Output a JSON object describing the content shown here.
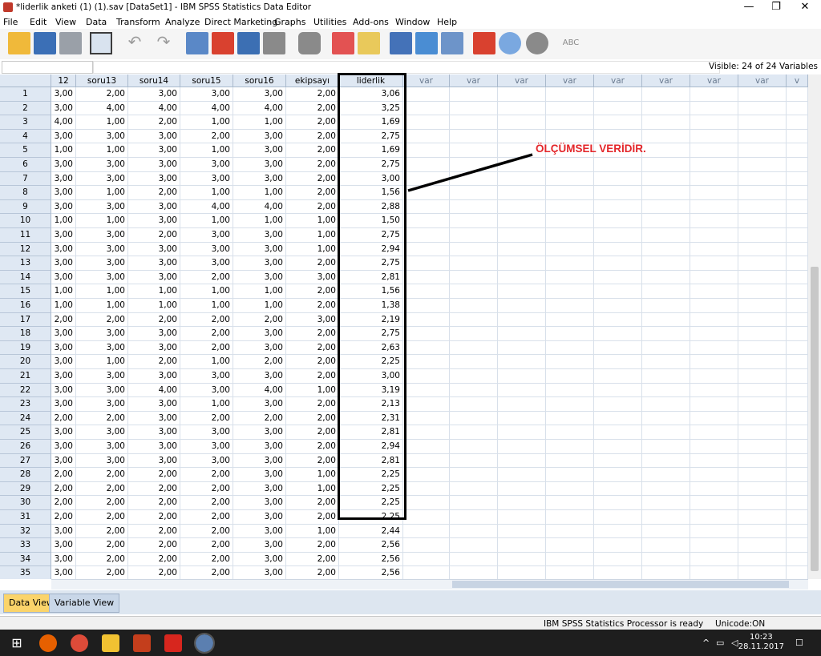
{
  "window": {
    "title": "*liderlik anketi (1) (1).sav [DataSet1] - IBM SPSS Statistics Data Editor"
  },
  "menu": [
    "File",
    "Edit",
    "View",
    "Data",
    "Transform",
    "Analyze",
    "Direct Marketing",
    "Graphs",
    "Utilities",
    "Add-ons",
    "Window",
    "Help"
  ],
  "cellbar": {
    "visible_text": "Visible: 24 of 24 Variables"
  },
  "columns": [
    "12",
    "soru13",
    "soru14",
    "soru15",
    "soru16",
    "ekipsayı",
    "liderlik",
    "var",
    "var",
    "var",
    "var",
    "var",
    "var",
    "var",
    "var",
    "v"
  ],
  "rows": [
    [
      "1",
      "3,00",
      "2,00",
      "3,00",
      "3,00",
      "3,00",
      "2,00",
      "3,06"
    ],
    [
      "2",
      "3,00",
      "4,00",
      "4,00",
      "4,00",
      "4,00",
      "2,00",
      "3,25"
    ],
    [
      "3",
      "4,00",
      "1,00",
      "2,00",
      "1,00",
      "1,00",
      "2,00",
      "1,69"
    ],
    [
      "4",
      "3,00",
      "3,00",
      "3,00",
      "2,00",
      "3,00",
      "2,00",
      "2,75"
    ],
    [
      "5",
      "1,00",
      "1,00",
      "3,00",
      "1,00",
      "3,00",
      "2,00",
      "1,69"
    ],
    [
      "6",
      "3,00",
      "3,00",
      "3,00",
      "3,00",
      "3,00",
      "2,00",
      "2,75"
    ],
    [
      "7",
      "3,00",
      "3,00",
      "3,00",
      "3,00",
      "3,00",
      "2,00",
      "3,00"
    ],
    [
      "8",
      "3,00",
      "1,00",
      "2,00",
      "1,00",
      "1,00",
      "2,00",
      "1,56"
    ],
    [
      "9",
      "3,00",
      "3,00",
      "3,00",
      "4,00",
      "4,00",
      "2,00",
      "2,88"
    ],
    [
      "10",
      "1,00",
      "1,00",
      "3,00",
      "1,00",
      "1,00",
      "1,00",
      "1,50"
    ],
    [
      "11",
      "3,00",
      "3,00",
      "2,00",
      "3,00",
      "3,00",
      "1,00",
      "2,75"
    ],
    [
      "12",
      "3,00",
      "3,00",
      "3,00",
      "3,00",
      "3,00",
      "1,00",
      "2,94"
    ],
    [
      "13",
      "3,00",
      "3,00",
      "3,00",
      "3,00",
      "3,00",
      "2,00",
      "2,75"
    ],
    [
      "14",
      "3,00",
      "3,00",
      "3,00",
      "2,00",
      "3,00",
      "3,00",
      "2,81"
    ],
    [
      "15",
      "1,00",
      "1,00",
      "1,00",
      "1,00",
      "1,00",
      "2,00",
      "1,56"
    ],
    [
      "16",
      "1,00",
      "1,00",
      "1,00",
      "1,00",
      "1,00",
      "2,00",
      "1,38"
    ],
    [
      "17",
      "2,00",
      "2,00",
      "2,00",
      "2,00",
      "2,00",
      "3,00",
      "2,19"
    ],
    [
      "18",
      "3,00",
      "3,00",
      "3,00",
      "2,00",
      "3,00",
      "2,00",
      "2,75"
    ],
    [
      "19",
      "3,00",
      "3,00",
      "3,00",
      "2,00",
      "3,00",
      "2,00",
      "2,63"
    ],
    [
      "20",
      "3,00",
      "1,00",
      "2,00",
      "1,00",
      "2,00",
      "2,00",
      "2,25"
    ],
    [
      "21",
      "3,00",
      "3,00",
      "3,00",
      "3,00",
      "3,00",
      "2,00",
      "3,00"
    ],
    [
      "22",
      "3,00",
      "3,00",
      "4,00",
      "3,00",
      "4,00",
      "1,00",
      "3,19"
    ],
    [
      "23",
      "3,00",
      "3,00",
      "3,00",
      "1,00",
      "3,00",
      "2,00",
      "2,13"
    ],
    [
      "24",
      "2,00",
      "2,00",
      "3,00",
      "2,00",
      "2,00",
      "2,00",
      "2,31"
    ],
    [
      "25",
      "3,00",
      "3,00",
      "3,00",
      "3,00",
      "3,00",
      "2,00",
      "2,81"
    ],
    [
      "26",
      "3,00",
      "3,00",
      "3,00",
      "3,00",
      "3,00",
      "2,00",
      "2,94"
    ],
    [
      "27",
      "3,00",
      "3,00",
      "3,00",
      "3,00",
      "3,00",
      "2,00",
      "2,81"
    ],
    [
      "28",
      "2,00",
      "2,00",
      "2,00",
      "2,00",
      "3,00",
      "1,00",
      "2,25"
    ],
    [
      "29",
      "2,00",
      "2,00",
      "2,00",
      "2,00",
      "3,00",
      "1,00",
      "2,25"
    ],
    [
      "30",
      "2,00",
      "2,00",
      "2,00",
      "2,00",
      "3,00",
      "2,00",
      "2,25"
    ],
    [
      "31",
      "2,00",
      "2,00",
      "2,00",
      "2,00",
      "3,00",
      "2,00",
      "2,25"
    ],
    [
      "32",
      "3,00",
      "2,00",
      "2,00",
      "2,00",
      "3,00",
      "1,00",
      "2,44"
    ],
    [
      "33",
      "3,00",
      "2,00",
      "2,00",
      "2,00",
      "3,00",
      "2,00",
      "2,56"
    ],
    [
      "34",
      "3,00",
      "2,00",
      "2,00",
      "2,00",
      "3,00",
      "2,00",
      "2,56"
    ],
    [
      "35",
      "3,00",
      "2,00",
      "2,00",
      "2,00",
      "3,00",
      "2,00",
      "2,56"
    ]
  ],
  "annotation": {
    "text": "ÖLÇÜMSEL VERİDİR.",
    "color": "#e3262a"
  },
  "tabs": {
    "data_view": "Data View",
    "variable_view": "Variable View"
  },
  "status": {
    "processor": "IBM SPSS Statistics Processor is ready",
    "unicode": "Unicode:ON"
  },
  "taskbar": {
    "time": "10:23",
    "date": "28.11.2017"
  },
  "icons": [
    "windows-start-icon",
    "firefox-icon",
    "chrome-icon",
    "file-explorer-icon",
    "powerpoint-icon",
    "pdf-icon",
    "spss-icon"
  ]
}
